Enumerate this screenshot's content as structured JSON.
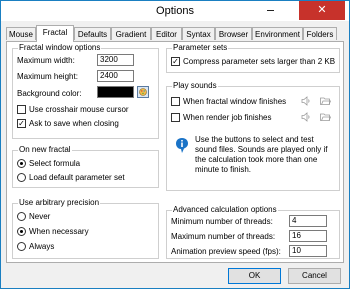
{
  "window": {
    "title": "Options",
    "close_glyph": "✕"
  },
  "tabs": [
    "Mouse",
    "Fractal",
    "Defaults",
    "Gradient",
    "Editor",
    "Syntax",
    "Browser",
    "Environment",
    "Folders"
  ],
  "active_tab": "Fractal",
  "fractal_window": {
    "legend": "Fractal window options",
    "max_width_label": "Maximum width:",
    "max_width": "3200",
    "max_height_label": "Maximum height:",
    "max_height": "2400",
    "bg_color_label": "Background color:",
    "bg_color": "#000000",
    "crosshair_label": "Use crosshair mouse cursor",
    "crosshair_checked": false,
    "ask_save_label": "Ask to save when closing",
    "ask_save_checked": true
  },
  "new_fractal": {
    "legend": "On new fractal",
    "options": [
      "Select formula",
      "Load default parameter set"
    ],
    "selected": 0
  },
  "arbitrary_precision": {
    "legend": "Use arbitrary precision",
    "options": [
      "Never",
      "When necessary",
      "Always"
    ],
    "selected": 1
  },
  "parameter_sets": {
    "legend": "Parameter sets",
    "compress_label": "Compress parameter sets larger than 2 KB",
    "compress_checked": true
  },
  "play_sounds": {
    "legend": "Play sounds",
    "window_finishes_label": "When fractal window finishes",
    "render_finishes_label": "When render job finishes",
    "info_text": "Use the buttons to select and test sound files. Sounds are played only if the calculation took more than one minute to finish."
  },
  "advanced": {
    "legend": "Advanced calculation options",
    "min_threads_label": "Minimum number of threads:",
    "min_threads": "4",
    "max_threads_label": "Maximum number of threads:",
    "max_threads": "16",
    "preview_speed_label": "Animation preview speed (fps):",
    "preview_speed": "10"
  },
  "buttons": {
    "ok": "OK",
    "cancel": "Cancel"
  },
  "colors": {
    "accent": "#0078d7",
    "close": "#c7322b",
    "info": "#1a73c7"
  }
}
